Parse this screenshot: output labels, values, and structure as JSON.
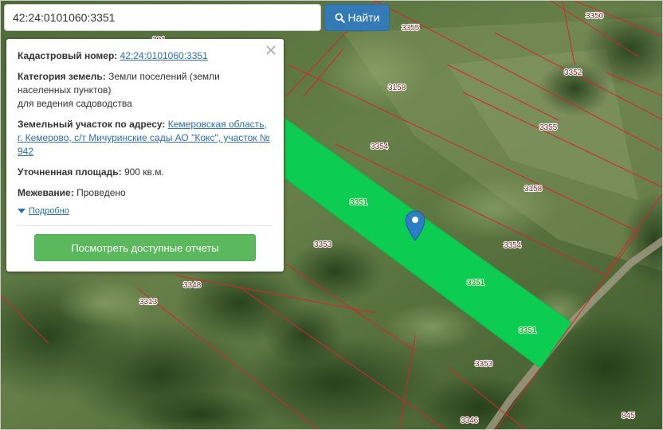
{
  "search": {
    "value": "42:24:0101060:3351",
    "button_label": "Найти"
  },
  "popup": {
    "cadastral_label": "Кадастровый номер:",
    "cadastral_number": "42:24:0101060:3351",
    "category_label": "Категория земель:",
    "category_line1": "Земли поселений (земли",
    "category_line2": "населенных пунктов)",
    "category_line3": "для ведения садоводства",
    "address_label": "Земельный участок по адресу:",
    "address_line1": "Кемеровская область,",
    "address_line2": "г. Кемерово, с/т Мичуринские сады АО \"Кокс\", участок №",
    "address_line3": "942",
    "area_label": "Уточненная площадь:",
    "area_value": "900 кв.м.",
    "survey_label": "Межевание:",
    "survey_value": "Проведено",
    "details_label": "Подробно",
    "reports_button": "Посмотреть доступные отчеты"
  },
  "map": {
    "parcel_labels": [
      "3350",
      "3355",
      "201",
      "3352",
      "3158",
      "3355",
      "3354",
      "3158",
      "3351",
      "3351",
      "3353",
      "3354",
      "3348",
      "3313",
      "3351",
      "3351",
      "3353",
      "3346",
      "845"
    ],
    "highlighted_parcel_color": "#0dd656",
    "boundary_color": "#d8242f",
    "marker_color": "#2d7dc6"
  },
  "icons": {
    "search": "search-icon",
    "close": "close-icon",
    "details": "caret-down-icon",
    "marker": "map-pin-icon"
  }
}
